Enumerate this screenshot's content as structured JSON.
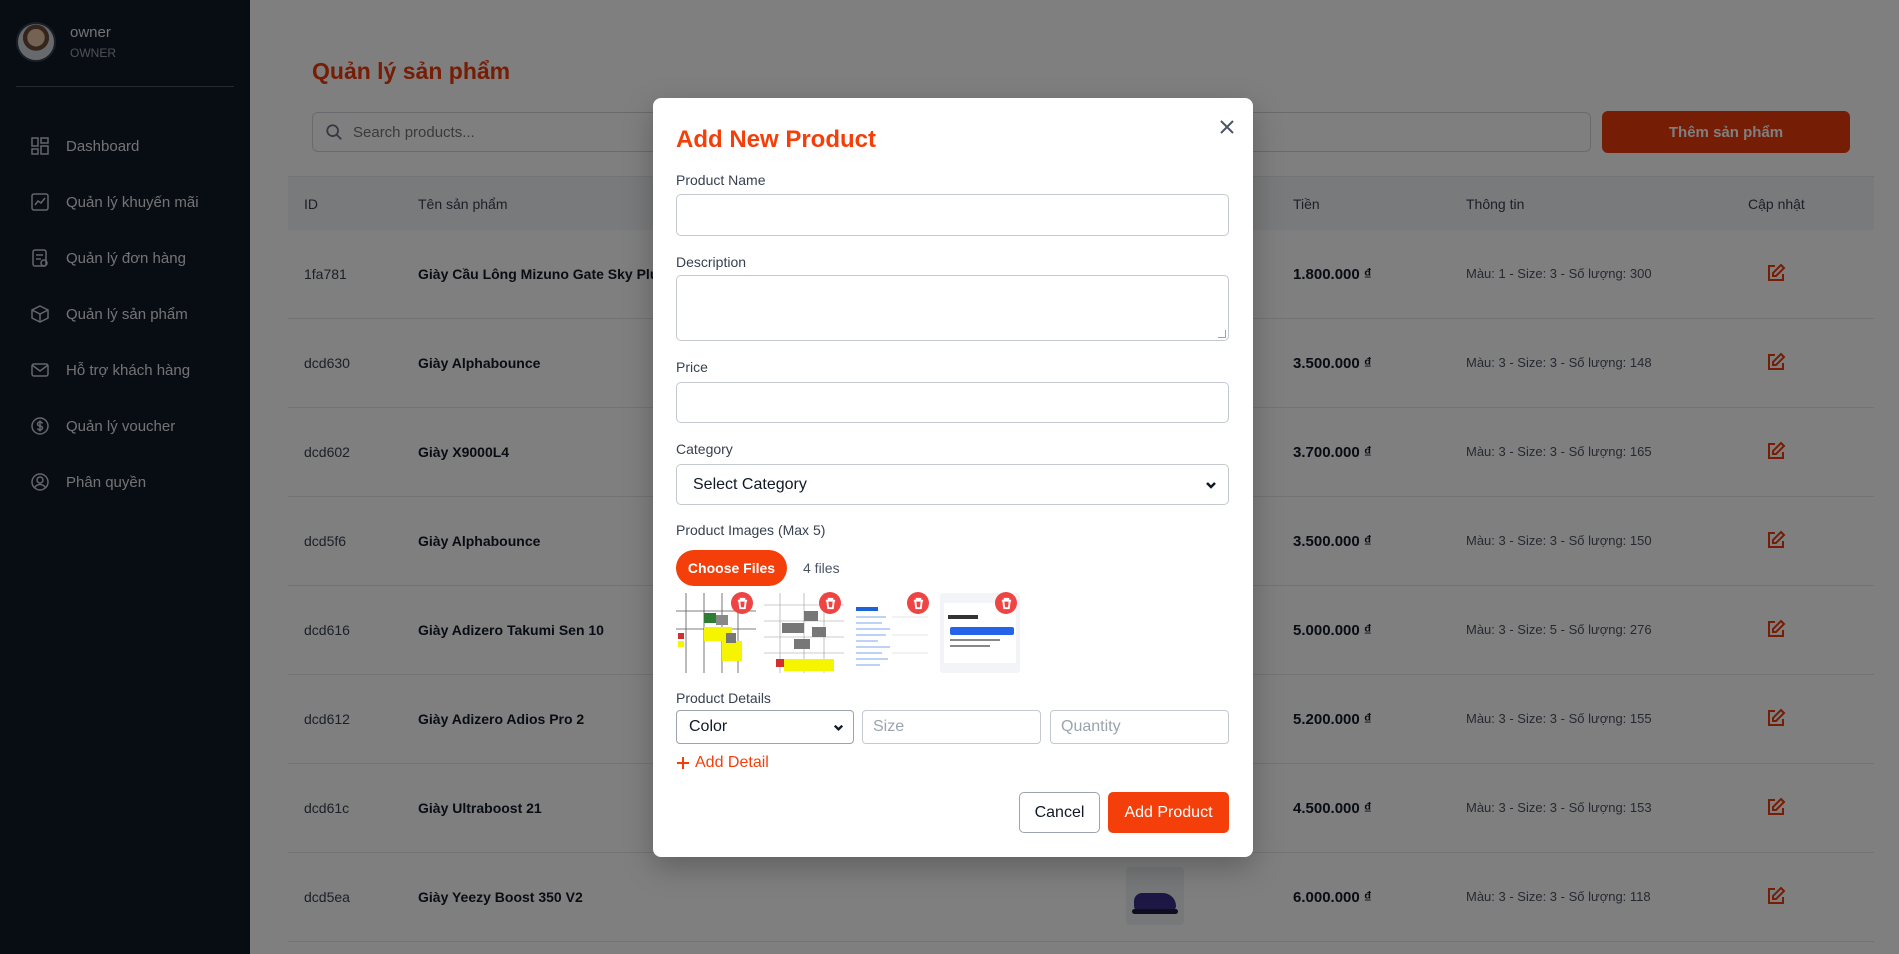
{
  "sidebar": {
    "user": {
      "name": "owner",
      "role": "OWNER"
    },
    "items": [
      {
        "label": "Dashboard",
        "icon": "dashboard-icon"
      },
      {
        "label": "Quản lý khuyến mãi",
        "icon": "chart-line-icon"
      },
      {
        "label": "Quản lý đơn hàng",
        "icon": "orders-icon"
      },
      {
        "label": "Quản lý sản phẩm",
        "icon": "box-icon"
      },
      {
        "label": "Hỗ trợ khách hàng",
        "icon": "mail-icon"
      },
      {
        "label": "Quản lý voucher",
        "icon": "coin-icon"
      },
      {
        "label": "Phân quyền",
        "icon": "user-circle-icon"
      }
    ]
  },
  "main": {
    "title": "Quản lý sản phẩm",
    "search_placeholder": "Search products...",
    "add_button": "Thêm sản phẩm",
    "columns": {
      "id": "ID",
      "name": "Tên sản phẩm",
      "price": "Tiền",
      "info": "Thông tin",
      "update": "Cập nhật"
    },
    "rows": [
      {
        "id": "1fa781",
        "name": "Giày Cầu Lông Mizuno Gate Sky Plus",
        "price": "1.800.000 ₫",
        "info": "Màu: 1 - Size: 3 - Số lượng: 300"
      },
      {
        "id": "dcd630",
        "name": "Giày Alphabounce",
        "price": "3.500.000 ₫",
        "info": "Màu: 3 - Size: 3 - Số lượng: 148"
      },
      {
        "id": "dcd602",
        "name": "Giày X9000L4",
        "price": "3.700.000 ₫",
        "info": "Màu: 3 - Size: 3 - Số lượng: 165"
      },
      {
        "id": "dcd5f6",
        "name": "Giày Alphabounce",
        "price": "3.500.000 ₫",
        "info": "Màu: 3 - Size: 3 - Số lượng: 150"
      },
      {
        "id": "dcd616",
        "name": "Giày Adizero Takumi Sen 10",
        "price": "5.000.000 ₫",
        "info": "Màu: 3 - Size: 5 - Số lượng: 276"
      },
      {
        "id": "dcd612",
        "name": "Giày Adizero Adios Pro 2",
        "price": "5.200.000 ₫",
        "info": "Màu: 3 - Size: 3 - Số lượng: 155"
      },
      {
        "id": "dcd61c",
        "name": "Giày Ultraboost 21",
        "price": "4.500.000 ₫",
        "info": "Màu: 3 - Size: 3 - Số lượng: 153"
      },
      {
        "id": "dcd5ea",
        "name": "Giày Yeezy Boost 350 V2",
        "price": "6.000.000 ₫",
        "info": "Màu: 3 - Size: 3 - Số lượng: 118"
      }
    ]
  },
  "modal": {
    "title": "Add New Product",
    "product_name_label": "Product Name",
    "product_name_value": "",
    "description_label": "Description",
    "description_value": "",
    "price_label": "Price",
    "price_value": "",
    "category_label": "Category",
    "category_value": "Select Category",
    "images_label": "Product Images (Max 5)",
    "choose_files": "Choose Files",
    "files_count": "4 files",
    "details_label": "Product Details",
    "color_value": "Color",
    "size_placeholder": "Size",
    "quantity_placeholder": "Quantity",
    "add_detail": "Add Detail",
    "cancel": "Cancel",
    "submit": "Add Product"
  },
  "colors": {
    "accent": "#f43f0a",
    "sidebar_bg": "#111827",
    "overlay": "rgba(0,0,0,0.5)"
  }
}
